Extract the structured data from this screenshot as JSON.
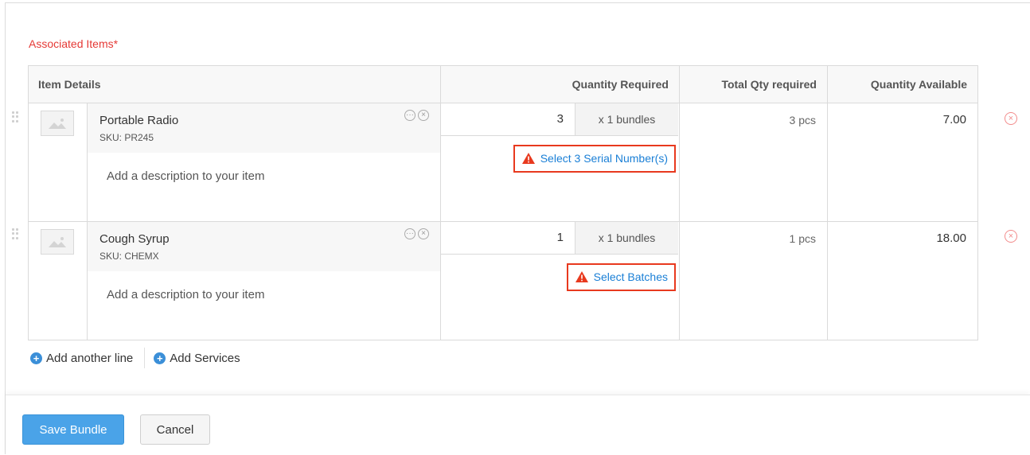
{
  "section": {
    "title": "Associated Items*"
  },
  "table": {
    "headers": {
      "item_details": "Item Details",
      "quantity_required": "Quantity Required",
      "total_qty_required": "Total Qty required",
      "quantity_available": "Quantity Available"
    },
    "rows": [
      {
        "name": "Portable Radio",
        "sku": "SKU: PR245",
        "description_placeholder": "Add a description to your item",
        "quantity": "3",
        "unit": "x 1 bundles",
        "action_label": "Select 3 Serial Number(s)",
        "total_qty": "3 pcs",
        "available": "7.00"
      },
      {
        "name": "Cough Syrup",
        "sku": "SKU: CHEMX",
        "description_placeholder": "Add a description to your item",
        "quantity": "1",
        "unit": "x 1 bundles",
        "action_label": "Select Batches",
        "total_qty": "1 pcs",
        "available": "18.00"
      }
    ]
  },
  "actions": {
    "add_line": "Add another line",
    "add_services": "Add Services"
  },
  "footer": {
    "save": "Save Bundle",
    "cancel": "Cancel"
  },
  "colors": {
    "required_label": "#e53935",
    "link": "#1a7fd6",
    "warning": "#e8391e",
    "primary_button": "#4aa3e8"
  },
  "icons": [
    "image-placeholder-icon",
    "more-icon",
    "close-icon",
    "warning-icon",
    "plus-circle-icon",
    "drag-handle-icon",
    "remove-icon"
  ]
}
